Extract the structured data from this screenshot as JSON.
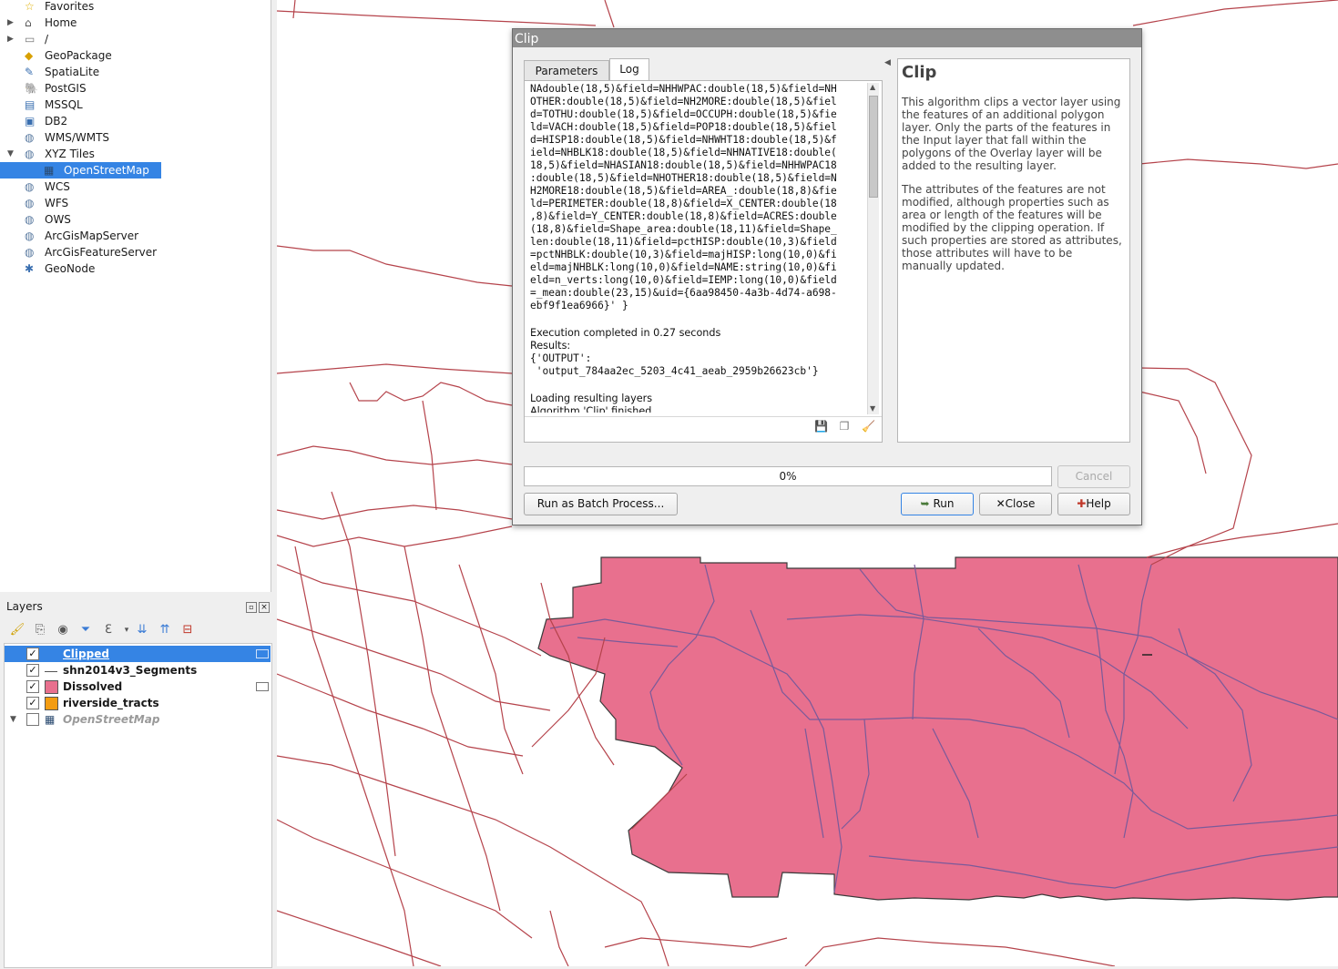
{
  "browser": {
    "items": [
      {
        "label": "Favorites",
        "icon": "star-icon",
        "expandable": false
      },
      {
        "label": "Home",
        "icon": "home-icon",
        "expandable": true
      },
      {
        "label": "/",
        "icon": "folder-icon",
        "expandable": true
      },
      {
        "label": "GeoPackage",
        "icon": "geopackage-icon",
        "expandable": false
      },
      {
        "label": "SpatiaLite",
        "icon": "spatialite-icon",
        "expandable": false
      },
      {
        "label": "PostGIS",
        "icon": "postgis-icon",
        "expandable": false
      },
      {
        "label": "MSSQL",
        "icon": "mssql-icon",
        "expandable": false
      },
      {
        "label": "DB2",
        "icon": "db2-icon",
        "expandable": false
      },
      {
        "label": "WMS/WMTS",
        "icon": "globe-icon",
        "expandable": false
      },
      {
        "label": "XYZ Tiles",
        "icon": "globe-icon",
        "expandable": true
      },
      {
        "label": "OpenStreetMap",
        "icon": "tiles-icon",
        "expandable": false
      },
      {
        "label": "WCS",
        "icon": "globe-icon",
        "expandable": false
      },
      {
        "label": "WFS",
        "icon": "globe-icon",
        "expandable": false
      },
      {
        "label": "OWS",
        "icon": "globe-icon",
        "expandable": false
      },
      {
        "label": "ArcGisMapServer",
        "icon": "globe-icon",
        "expandable": false
      },
      {
        "label": "ArcGisFeatureServer",
        "icon": "globe-icon",
        "expandable": false
      },
      {
        "label": "GeoNode",
        "icon": "geonode-icon",
        "expandable": false
      }
    ]
  },
  "layers": {
    "title": "Layers",
    "items": [
      {
        "name": "Clipped",
        "checked": true,
        "symbol": "none"
      },
      {
        "name": "shn2014v3_Segments",
        "checked": true,
        "symbol": "line"
      },
      {
        "name": "Dissolved",
        "checked": true,
        "symbol": "fill",
        "color": "#e8708e"
      },
      {
        "name": "riverside_tracts",
        "checked": true,
        "symbol": "fill",
        "color": "#f39c12"
      },
      {
        "name": "OpenStreetMap",
        "checked": false,
        "symbol": "tiles"
      }
    ]
  },
  "dialog": {
    "title": "Clip",
    "tabs": [
      "Parameters",
      "Log"
    ],
    "log_lines": [
      "NAdouble(18,5)&field=NHHWPAC:double(18,5)&field=NH",
      "OTHER:double(18,5)&field=NH2MORE:double(18,5)&fiel",
      "d=TOTHU:double(18,5)&field=OCCUPH:double(18,5)&fie",
      "ld=VACH:double(18,5)&field=POP18:double(18,5)&fiel",
      "d=HISP18:double(18,5)&field=NHWHT18:double(18,5)&f",
      "ield=NHBLK18:double(18,5)&field=NHNATIVE18:double(",
      "18,5)&field=NHASIAN18:double(18,5)&field=NHHWPAC18",
      ":double(18,5)&field=NHOTHER18:double(18,5)&field=N",
      "H2MORE18:double(18,5)&field=AREA_:double(18,8)&fie",
      "ld=PERIMETER:double(18,8)&field=X_CENTER:double(18",
      ",8)&field=Y_CENTER:double(18,8)&field=ACRES:double",
      "(18,8)&field=Shape_area:double(18,11)&field=Shape_",
      "len:double(18,11)&field=pctHISP:double(10,3)&field",
      "=pctNHBLK:double(10,3)&field=majHISP:long(10,0)&fi",
      "eld=majNHBLK:long(10,0)&field=NAME:string(10,0)&fi",
      "eld=n_verts:long(10,0)&field=IEMP:long(10,0)&field",
      "=_mean:double(23,15)&uid={6aa98450-4a3b-4d74-a698-",
      "ebf9f1ea6966}' }"
    ],
    "exec_text": "Execution completed in 0.27 seconds",
    "results_label": "Results:",
    "output_line1": "{'OUTPUT':",
    "output_line2": " 'output_784aa2ec_5203_4c41_aeab_2959b26623cb'}",
    "loading_text": "Loading resulting layers",
    "finished_text": "Algorithm 'Clip' finished",
    "help_title": "Clip",
    "help_p1": "This algorithm clips a vector layer using the features of an additional polygon layer. Only the parts of the features in the Input layer that fall within the polygons of the Overlay layer will be added to the resulting layer.",
    "help_p2": "The attributes of the features are not modified, although properties such as area or length of the features will be modified by the clipping operation. If such properties are stored as attributes, those attributes will have to be manually updated.",
    "progress_text": "0%",
    "progress": 0,
    "cancel_label": "Cancel",
    "batch_label": "Run as Batch Process...",
    "run_label": "Run",
    "close_label": "Close",
    "help_label": "Help"
  },
  "colors": {
    "road": "#b5434b",
    "dissolved_fill": "#e8708e",
    "selection": "#3584e4"
  }
}
